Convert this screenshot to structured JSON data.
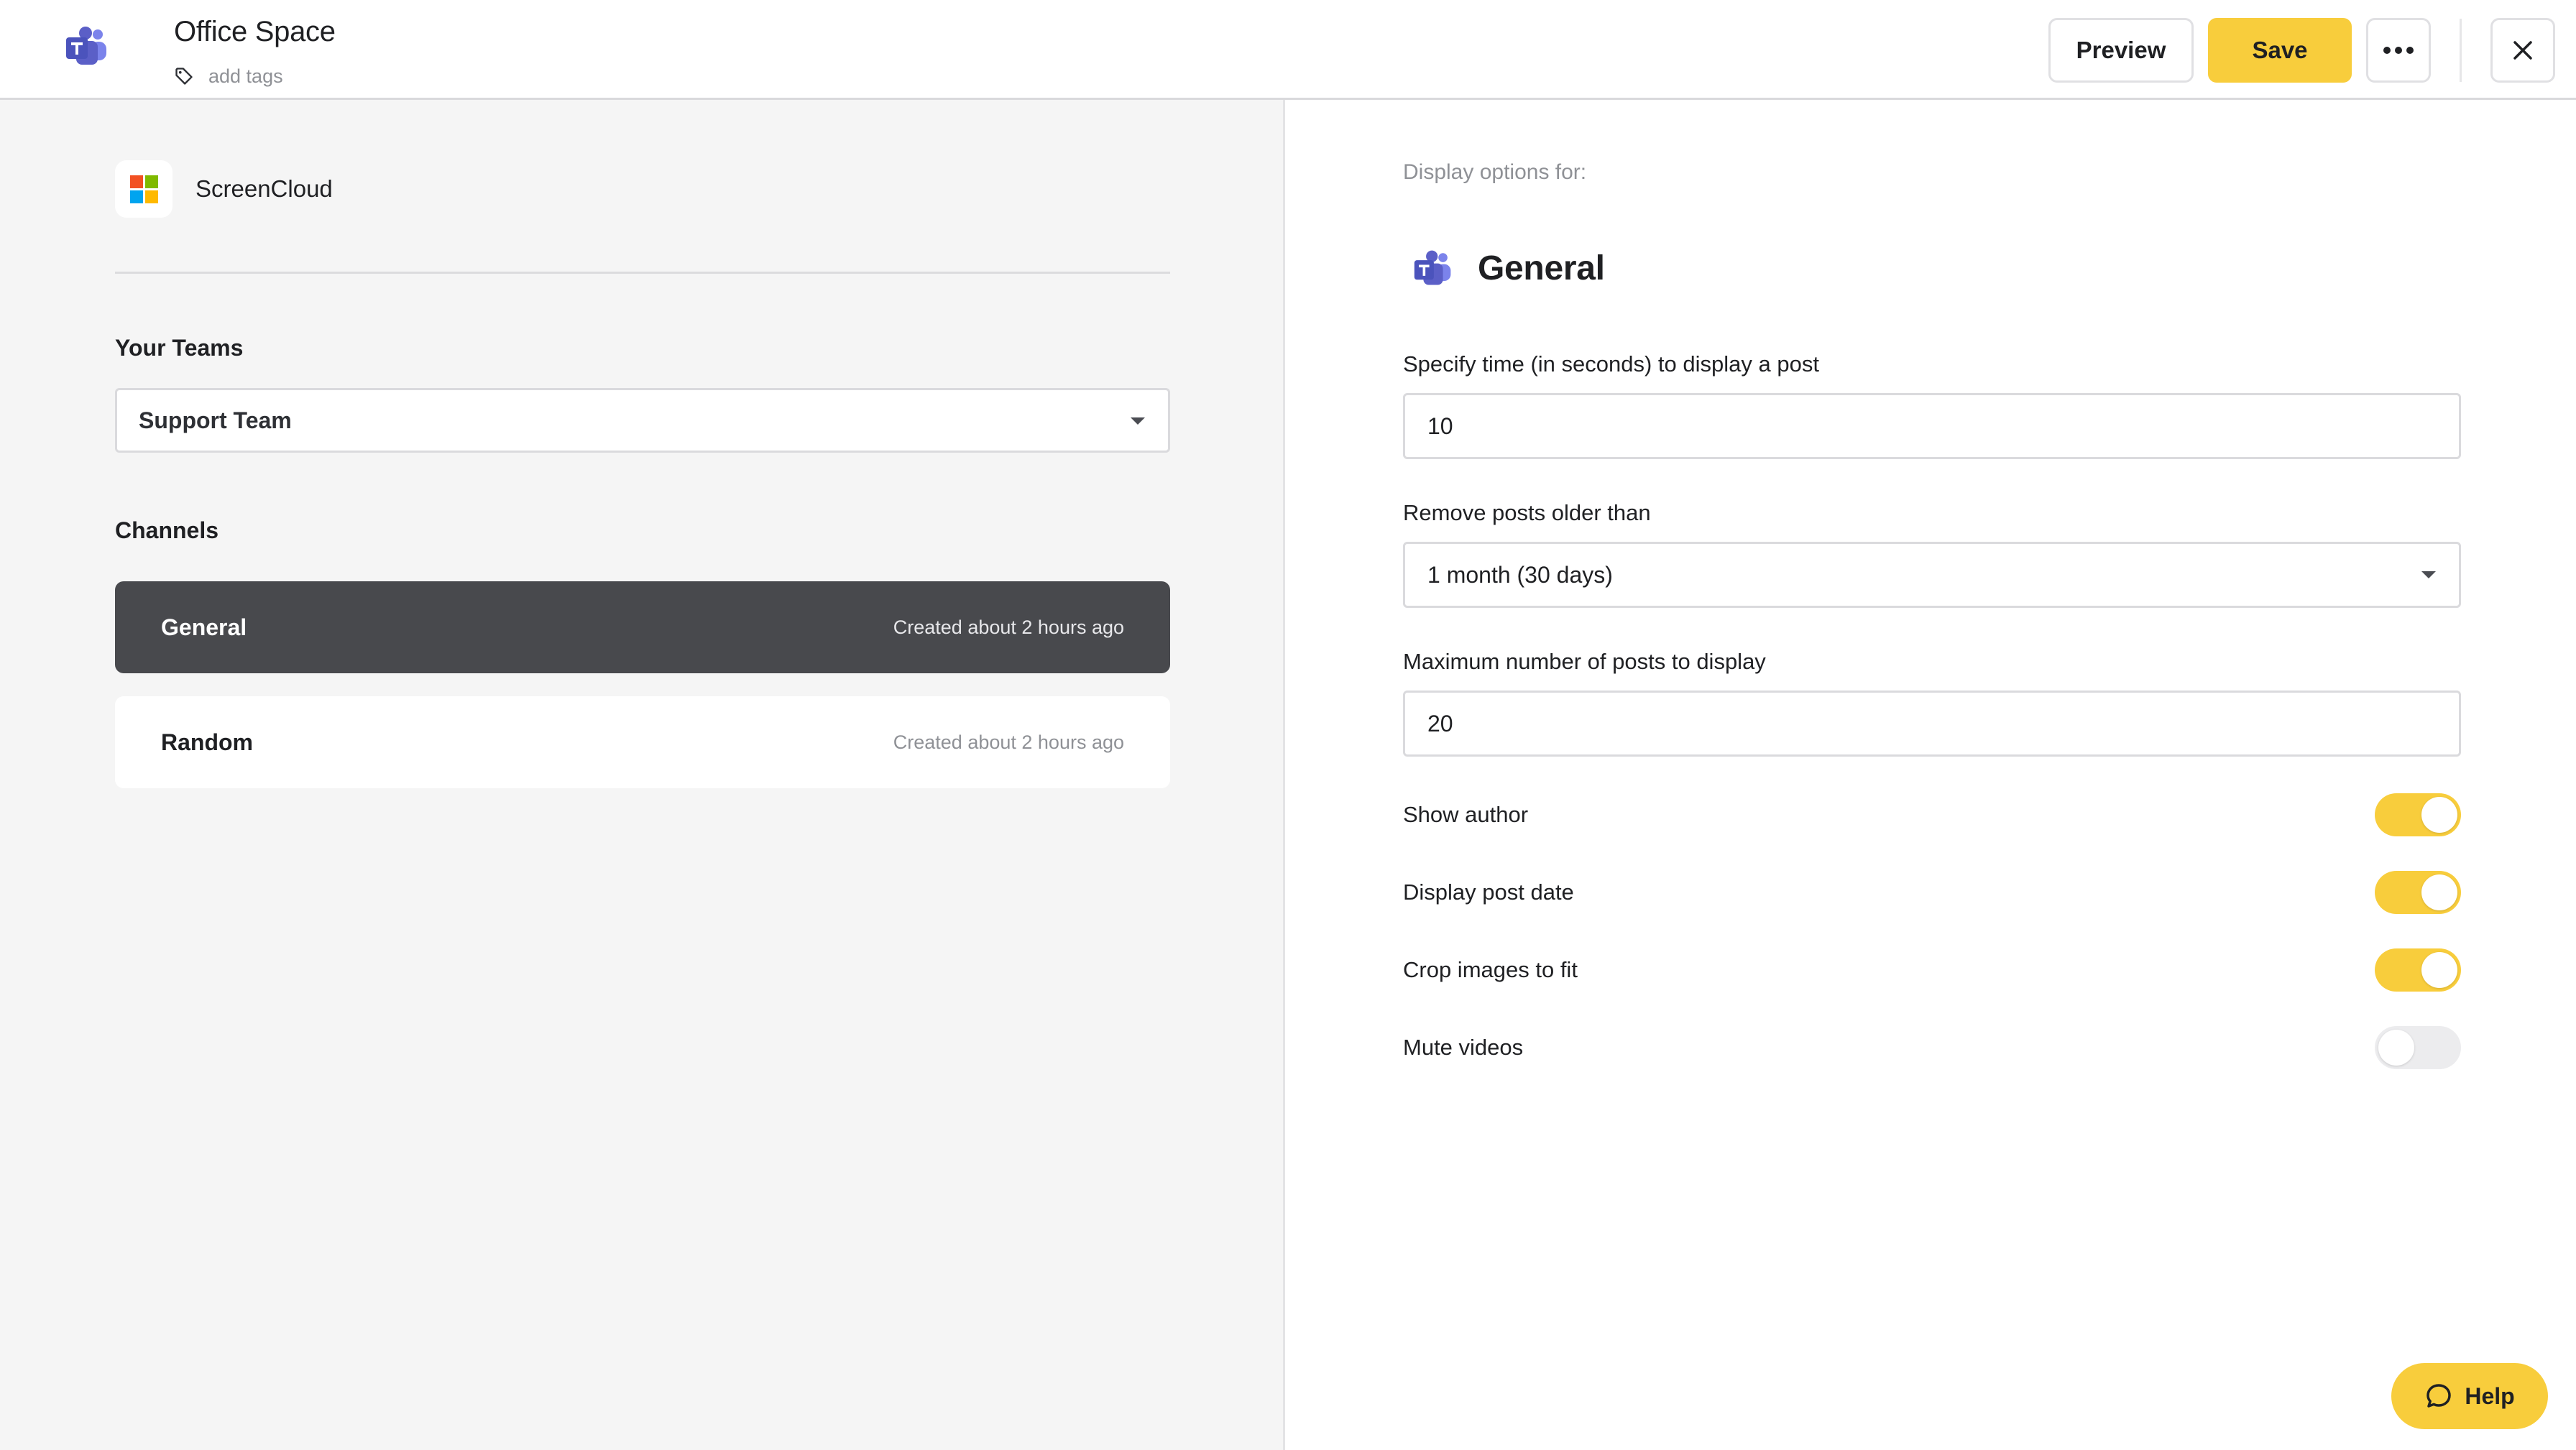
{
  "header": {
    "title": "Office Space",
    "tags_placeholder": "add tags",
    "preview_label": "Preview",
    "save_label": "Save",
    "icons": [
      "teams-logo",
      "tag-icon",
      "more-icon",
      "close-icon"
    ]
  },
  "sidebar": {
    "account_name": "ScreenCloud",
    "teams_label": "Your Teams",
    "selected_team": "Support Team",
    "channels_label": "Channels",
    "channels": [
      {
        "name": "General",
        "meta": "Created about 2 hours ago",
        "active": true
      },
      {
        "name": "Random",
        "meta": "Created about 2 hours ago",
        "active": false
      }
    ]
  },
  "settings": {
    "display_for_label": "Display options for:",
    "channel_name": "General",
    "time_label": "Specify time (in seconds) to display a post",
    "time_value": "10",
    "older_label": "Remove posts older than",
    "older_value": "1 month (30 days)",
    "max_label": "Maximum number of posts to display",
    "max_value": "20",
    "toggles": [
      {
        "label": "Show author",
        "on": true
      },
      {
        "label": "Display post date",
        "on": true
      },
      {
        "label": "Crop images to fit",
        "on": true
      },
      {
        "label": "Mute videos",
        "on": false
      }
    ]
  },
  "help": {
    "label": "Help"
  },
  "colors": {
    "accent": "#f8cd3c",
    "active_channel_bg": "#48494d",
    "teams_purple": "#5b5fc7",
    "ms_red": "#f25022",
    "ms_green": "#7fba00",
    "ms_blue": "#00a4ef",
    "ms_yellow": "#ffb900"
  }
}
